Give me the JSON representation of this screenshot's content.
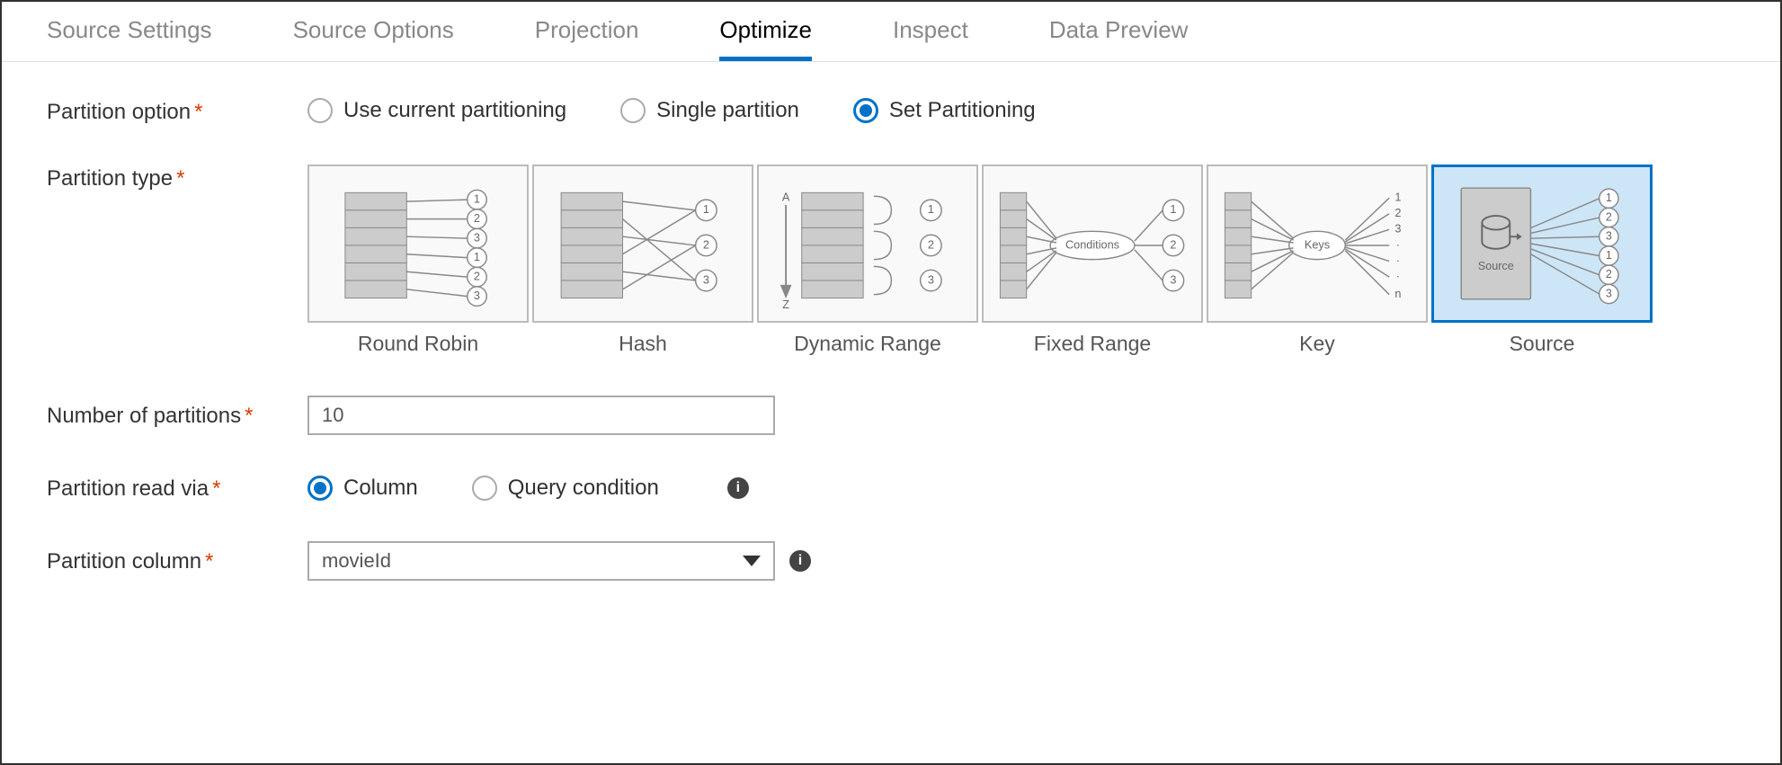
{
  "tabs": [
    {
      "label": "Source Settings"
    },
    {
      "label": "Source Options"
    },
    {
      "label": "Projection"
    },
    {
      "label": "Optimize",
      "active": true
    },
    {
      "label": "Inspect"
    },
    {
      "label": "Data Preview"
    }
  ],
  "partition_option": {
    "label": "Partition option",
    "options": [
      "Use current partitioning",
      "Single partition",
      "Set Partitioning"
    ],
    "selected": "Set Partitioning"
  },
  "partition_type": {
    "label": "Partition type",
    "types": [
      "Round Robin",
      "Hash",
      "Dynamic Range",
      "Fixed Range",
      "Key",
      "Source"
    ],
    "selected": "Source"
  },
  "number_of_partitions": {
    "label": "Number of partitions",
    "value": "10"
  },
  "partition_read_via": {
    "label": "Partition read via",
    "options": [
      "Column",
      "Query condition"
    ],
    "selected": "Column"
  },
  "partition_column": {
    "label": "Partition column",
    "value": "movieId"
  },
  "card_internal": {
    "conditions": "Conditions",
    "keys": "Keys",
    "source": "Source",
    "a": "A",
    "z": "Z",
    "n": "n"
  }
}
